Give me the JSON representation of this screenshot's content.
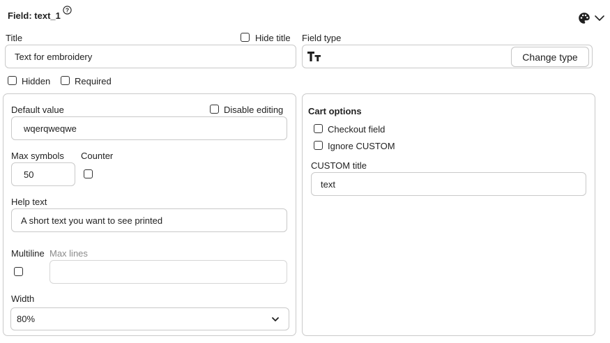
{
  "header": {
    "field_title": "Field: text_1",
    "help_icon": "help-circle-icon",
    "palette_icon": "palette-icon",
    "chevron_icon": "chevron-down-icon"
  },
  "title_section": {
    "title_label": "Title",
    "title_value": "Text for embroidery",
    "hide_title_label": "Hide title",
    "hide_title_checked": false
  },
  "field_type": {
    "label": "Field type",
    "type_icon": "text-type-icon",
    "type_glyph": "Tт",
    "change_button": "Change type"
  },
  "flags": {
    "hidden_label": "Hidden",
    "hidden_checked": false,
    "required_label": "Required",
    "required_checked": false
  },
  "left_panel": {
    "default_value_label": "Default value",
    "default_value": "wqerqweqwe",
    "disable_editing_label": "Disable editing",
    "disable_editing_checked": false,
    "max_symbols_label": "Max symbols",
    "max_symbols_value": "50",
    "counter_label": "Counter",
    "counter_checked": false,
    "help_text_label": "Help text",
    "help_text_value": "A short text you want to see printed",
    "multiline_label": "Multiline",
    "multiline_checked": false,
    "max_lines_label": "Max lines",
    "max_lines_value": "",
    "width_label": "Width",
    "width_value": "80%"
  },
  "right_panel": {
    "cart_options_title": "Cart options",
    "checkout_field_label": "Checkout field",
    "checkout_field_checked": false,
    "ignore_custom_label": "Ignore CUSTOM",
    "ignore_custom_checked": false,
    "custom_title_label": "CUSTOM title",
    "custom_title_value": "text"
  },
  "colors": {
    "border": "#c9c9c9",
    "text": "#1f1f1f",
    "muted": "#8a8a8a",
    "background": "#ffffff"
  }
}
